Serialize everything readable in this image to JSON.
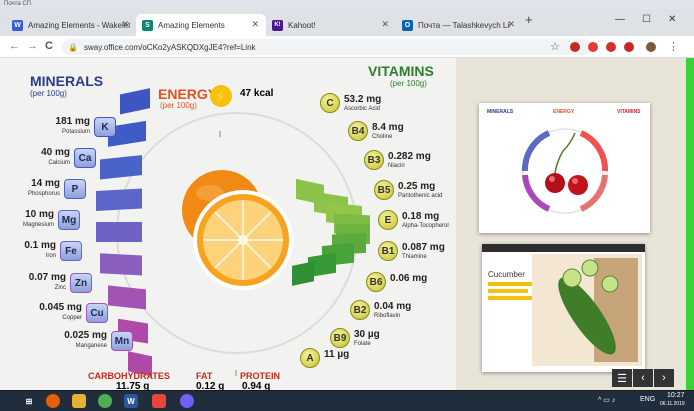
{
  "window": {
    "topstrip_label": "Почта СП"
  },
  "tabs": [
    {
      "label": "Amazing Elements - Wakelet",
      "icon": "W",
      "color": "#3a5bd9"
    },
    {
      "label": "Amazing Elements",
      "icon": "S",
      "color": "#108272",
      "active": true
    },
    {
      "label": "Kahoot!",
      "icon": "K!",
      "color": "#46178f"
    },
    {
      "label": "Почта — Talashkevych Liudmyla",
      "icon": "O",
      "color": "#0a64ad"
    }
  ],
  "browser": {
    "url": "sway.office.com/oCKo2yASKQDXgJE4?ref=Link",
    "back": "←",
    "forward": "→",
    "reload": "C",
    "new_tab": "+",
    "win_min": "—",
    "win_max": "☐",
    "win_close": "✕",
    "star": "☆"
  },
  "poster": {
    "minerals": {
      "title": "MINERALS",
      "sub": "(per 100g)"
    },
    "vitamins": {
      "title": "VITAMINS",
      "sub": "(per 100g)"
    },
    "energy": {
      "title": "ENERGY",
      "sub": "(per 100g)",
      "value": "47 kcal"
    },
    "mineral_rows": [
      {
        "value": "181",
        "unit": "mg",
        "name": "Potassium",
        "symbol": "K"
      },
      {
        "value": "40",
        "unit": "mg",
        "name": "Calcium",
        "symbol": "Ca"
      },
      {
        "value": "14",
        "unit": "mg",
        "name": "Phosphorus",
        "symbol": "P"
      },
      {
        "value": "10",
        "unit": "mg",
        "name": "Magnesium",
        "symbol": "Mg"
      },
      {
        "value": "0.1",
        "unit": "mg",
        "name": "Iron",
        "symbol": "Fe"
      },
      {
        "value": "0.07",
        "unit": "mg",
        "name": "Zinc",
        "symbol": "Zn"
      },
      {
        "value": "0.045",
        "unit": "mg",
        "name": "Copper",
        "symbol": "Cu"
      },
      {
        "value": "0.025",
        "unit": "mg",
        "name": "Manganese",
        "symbol": "Mn"
      }
    ],
    "vitamin_rows": [
      {
        "value": "53.2 mg",
        "name": "Ascorbic Acid",
        "symbol": "C"
      },
      {
        "value": "8.4 mg",
        "name": "Choline",
        "symbol": "B4"
      },
      {
        "value": "0.282 mg",
        "name": "Niacin",
        "symbol": "B3"
      },
      {
        "value": "0.25 mg",
        "name": "Pantothenic acid",
        "symbol": "B5"
      },
      {
        "value": "0.18 mg",
        "name": "Alpha-Tocopherol",
        "symbol": "E"
      },
      {
        "value": "0.087 mg",
        "name": "Thiamine",
        "symbol": "B1"
      },
      {
        "value": "0.06 mg",
        "name": "",
        "symbol": "B6"
      },
      {
        "value": "0.04 mg",
        "name": "Riboflavin",
        "symbol": "B2"
      },
      {
        "value": "30 µg",
        "name": "Folate",
        "symbol": "B9"
      },
      {
        "value": "11 µg",
        "name": "",
        "symbol": "A"
      }
    ],
    "bottom": {
      "carb_label": "CARBOHYDRATES",
      "carb_value": "11.75 g",
      "fat_label": "FAT",
      "fat_value": "0.12 g",
      "protein_label": "PROTEIN",
      "protein_value": "0.94 g"
    }
  },
  "thumbs": {
    "t1_title_left": "MINERALS",
    "t1_title_right": "VITAMINS",
    "t1_energy": "ENERGY",
    "t2_title": "Cucumber"
  },
  "controls": {
    "nav_icon": "☰",
    "prev": "‹",
    "next": "›"
  },
  "taskbar": {
    "lang": "ENG",
    "time": "10:27",
    "date": "06.11.2019"
  },
  "colors": {
    "minerals": "#2b3a8c",
    "vitamins": "#2f7d2f",
    "energy": "#e0521f",
    "bottom": "#c42a1a"
  }
}
